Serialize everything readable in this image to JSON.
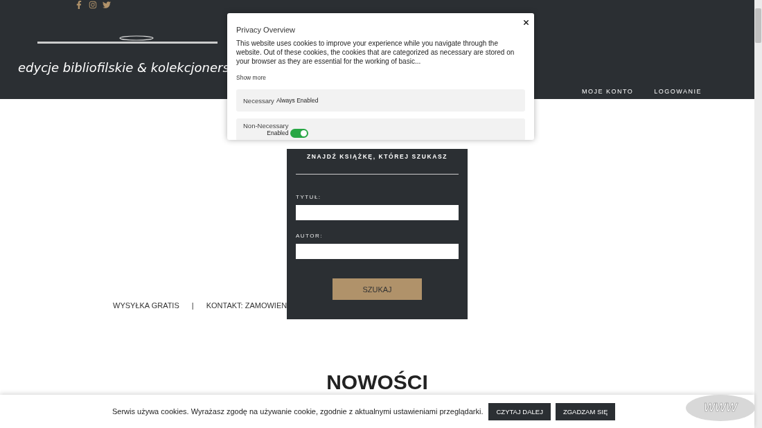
{
  "header": {
    "tagline": "edycje bibliofilskie & kolekcjoners",
    "nav": [
      {
        "label": "MOJE KONTO"
      },
      {
        "label": "LOGOWANIE"
      }
    ]
  },
  "privacy_modal": {
    "title": "Privacy Overview",
    "text": "This website uses cookies to improve your experience while you navigate through the website. Out of these cookies, the cookies that are categorized as necessary are stored on your browser as they are essential for the working of basic...",
    "show_more": "Show more",
    "categories": [
      {
        "kind": "fixed",
        "name": "Necessary",
        "status": "Always Enabled"
      },
      {
        "kind": "toggle",
        "name": "Non-Necessary",
        "status": "Enabled",
        "on": true
      }
    ]
  },
  "search_panel": {
    "title": "ZNAJDŹ KSIĄŻKĘ, KTÓREJ SZUKASZ",
    "fields": [
      {
        "label": "TYTUŁ:"
      },
      {
        "label": "AUTOR:"
      }
    ],
    "button": "SZUKAJ"
  },
  "info_bar": [
    "WYSYŁKA GRATIS",
    "|",
    "KONTAKT: ZAMOWIEN"
  ],
  "section_heading": "NOWOŚCI",
  "cookie_bar": {
    "text": "Serwis używa cookies. Wyrażasz zgodę na używanie cookie, zgodnie z aktualnymi ustawieniami przeglądarki.",
    "buttons": [
      "CZYTAJ DALEJ",
      "ZGADZAM SIĘ"
    ]
  },
  "badge": "WWW"
}
